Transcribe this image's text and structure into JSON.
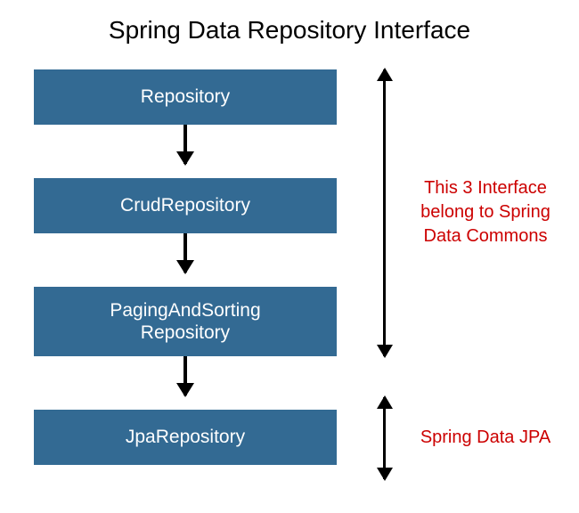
{
  "title": "Spring Data Repository Interface",
  "boxes": {
    "repository": "Repository",
    "crud": "CrudRepository",
    "paging_line1": "PagingAndSorting",
    "paging_line2": "Repository",
    "jpa": "JpaRepository"
  },
  "annotations": {
    "commons_line1": "This 3 Interface",
    "commons_line2": "belong to Spring",
    "commons_line3": "Data Commons",
    "jpa": "Spring Data JPA"
  },
  "colors": {
    "box_bg": "#336a93",
    "box_text": "#ffffff",
    "annotation": "#cc0000"
  }
}
